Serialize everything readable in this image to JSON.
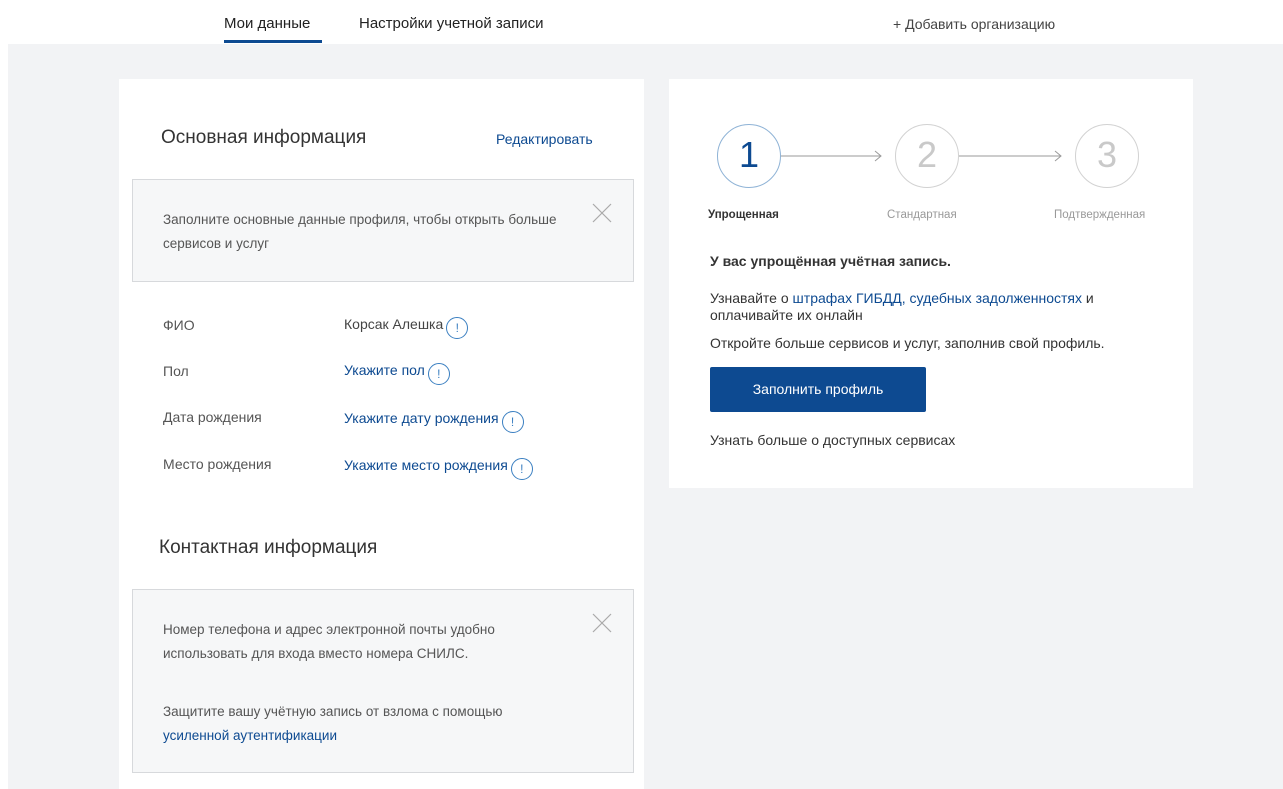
{
  "nav": {
    "tab_my_data": "Мои данные",
    "tab_account_settings": "Настройки учетной записи",
    "add_organization": "+ Добавить организацию"
  },
  "main_info": {
    "title": "Основная информация",
    "edit_link": "Редактировать",
    "notice": "Заполните основные данные профиля, чтобы открыть больше сервисов и услуг",
    "fields": [
      {
        "label": "ФИО",
        "value": "Корсак Алешка",
        "is_link": false
      },
      {
        "label": "Пол",
        "value": "Укажите пол",
        "is_link": true
      },
      {
        "label": "Дата рождения",
        "value": "Укажите дату рождения",
        "is_link": true
      },
      {
        "label": "Место рождения",
        "value": "Укажите место рождения",
        "is_link": true
      }
    ],
    "warning_glyph": "!"
  },
  "contact_info": {
    "title": "Контактная информация",
    "notice_1": "Номер телефона и адрес электронной почты удобно использовать для входа вместо номера СНИЛС.",
    "notice_2_prefix": "Защитите вашу учётную запись от взлома с помощью",
    "notice_2_link": "усиленной аутентификации"
  },
  "account_level": {
    "steps": [
      {
        "number": "1",
        "label": "Упрощенная",
        "active": true
      },
      {
        "number": "2",
        "label": "Стандартная",
        "active": false
      },
      {
        "number": "3",
        "label": "Подтвержденная",
        "active": false
      }
    ],
    "heading": "У вас упрощённая учётная запись.",
    "text1_prefix": "Узнавайте о",
    "text1_link": "штрафах ГИБДД, судебных задолженностях",
    "text1_suffix": "и",
    "text1_line2": "оплачивайте их онлайн",
    "text2": "Откройте больше сервисов и услуг, заполнив свой профиль.",
    "fill_button": "Заполнить профиль",
    "more_link": "Узнать больше о доступных сервисах"
  },
  "colors": {
    "accent": "#0d4a91",
    "page_bg": "#f2f3f5",
    "notice_bg": "#f6f7f8"
  },
  "icons": [
    "close-icon",
    "warning-icon",
    "arrow-right-icon"
  ]
}
